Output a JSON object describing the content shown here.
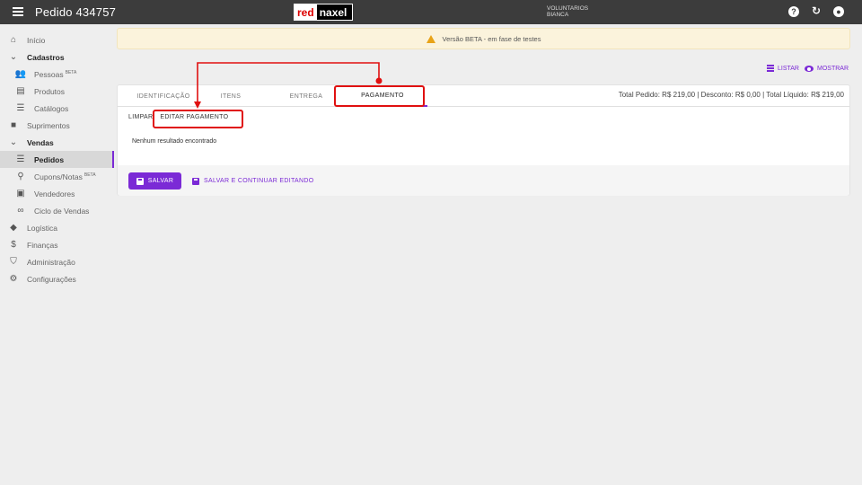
{
  "header": {
    "title": "Pedido 434757",
    "logo_left": "red",
    "logo_right": "naxel",
    "user_line1": "VOLUNTARIOS",
    "user_line2": "BIANCA",
    "icons": [
      "help-icon",
      "refresh-icon",
      "account-icon"
    ]
  },
  "sidebar": {
    "items": [
      {
        "label": "Início",
        "icon": "home-icon"
      },
      {
        "label": "Cadastros",
        "icon": "chevron-down-icon"
      },
      {
        "label": "Pessoas",
        "badge": "BETA",
        "icon": "people-icon"
      },
      {
        "label": "Produtos",
        "icon": "product-icon"
      },
      {
        "label": "Catálogos",
        "icon": "list-icon"
      },
      {
        "label": "Suprimentos",
        "icon": "briefcase-icon"
      },
      {
        "label": "Vendas",
        "icon": "chevron-down-icon"
      },
      {
        "label": "Pedidos",
        "icon": "list-icon"
      },
      {
        "label": "Cupons/Notas",
        "badge": "BETA",
        "icon": "receipt-search-icon"
      },
      {
        "label": "Vendedores",
        "icon": "badge-icon"
      },
      {
        "label": "Ciclo de Vendas",
        "icon": "infinity-icon"
      },
      {
        "label": "Logística",
        "icon": "route-icon"
      },
      {
        "label": "Finanças",
        "icon": "dollar-icon"
      },
      {
        "label": "Administração",
        "icon": "shield-icon"
      },
      {
        "label": "Configurações",
        "icon": "gear-icon"
      }
    ]
  },
  "banner": {
    "text": "Versão BETA - em fase de testes",
    "icon": "warning-icon"
  },
  "actions": {
    "list_label": "LISTAR",
    "show_label": "MOSTRAR"
  },
  "tabs": [
    {
      "label": "IDENTIFICAÇÃO"
    },
    {
      "label": "ITENS"
    },
    {
      "label": "ENTREGA"
    },
    {
      "label": "PAGAMENTO"
    }
  ],
  "subtabs": {
    "clear": "LIMPAR",
    "edit": "EDITAR PAGAMENTO"
  },
  "empty_message": "Nenhum resultado encontrado",
  "footer": {
    "save_label": "SALVAR",
    "save_continue_label": "SALVAR E CONTINUAR EDITANDO",
    "totals": "Total Pedido: R$ 219,00 | Desconto: R$ 0,00 | Total Líquido: R$ 219,00"
  },
  "colors": {
    "accent": "#7b2ad6",
    "topbar": "#3c3c3c",
    "annotation": "#e01010"
  }
}
